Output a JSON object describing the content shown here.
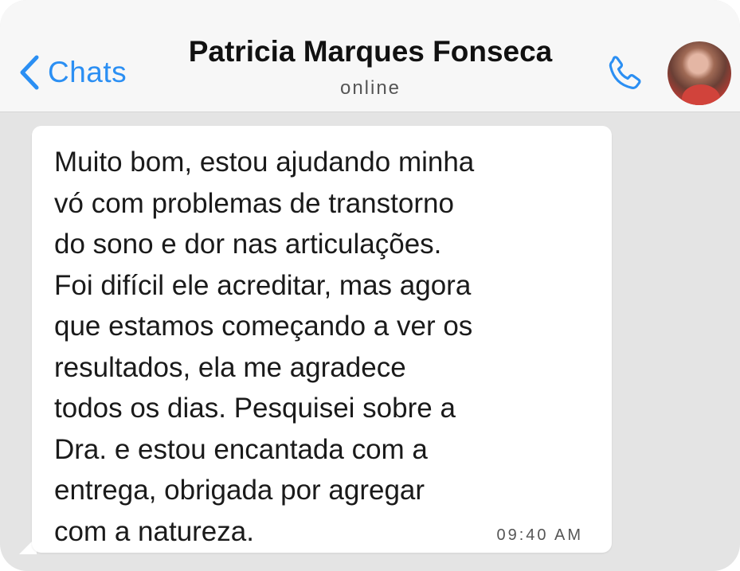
{
  "header": {
    "back_label": "Chats",
    "contact_name": "Patricia Marques Fonseca",
    "status": "online",
    "accent_color": "#2b8ff3"
  },
  "icons": {
    "back": "chevron-left-icon",
    "call": "phone-icon",
    "avatar": "contact-avatar"
  },
  "message": {
    "text": "Muito bom, estou ajudando minha\nvó com problemas de transtorno\ndo sono e dor nas articulações.\nFoi difícil ele acreditar, mas agora\nque estamos começando a ver os\nresultados, ela me agradece\ntodos os dias. Pesquisei sobre a\nDra. e estou encantada com a\nentrega, obrigada por agregar\ncom a natureza.",
    "time": "09:40 AM"
  }
}
